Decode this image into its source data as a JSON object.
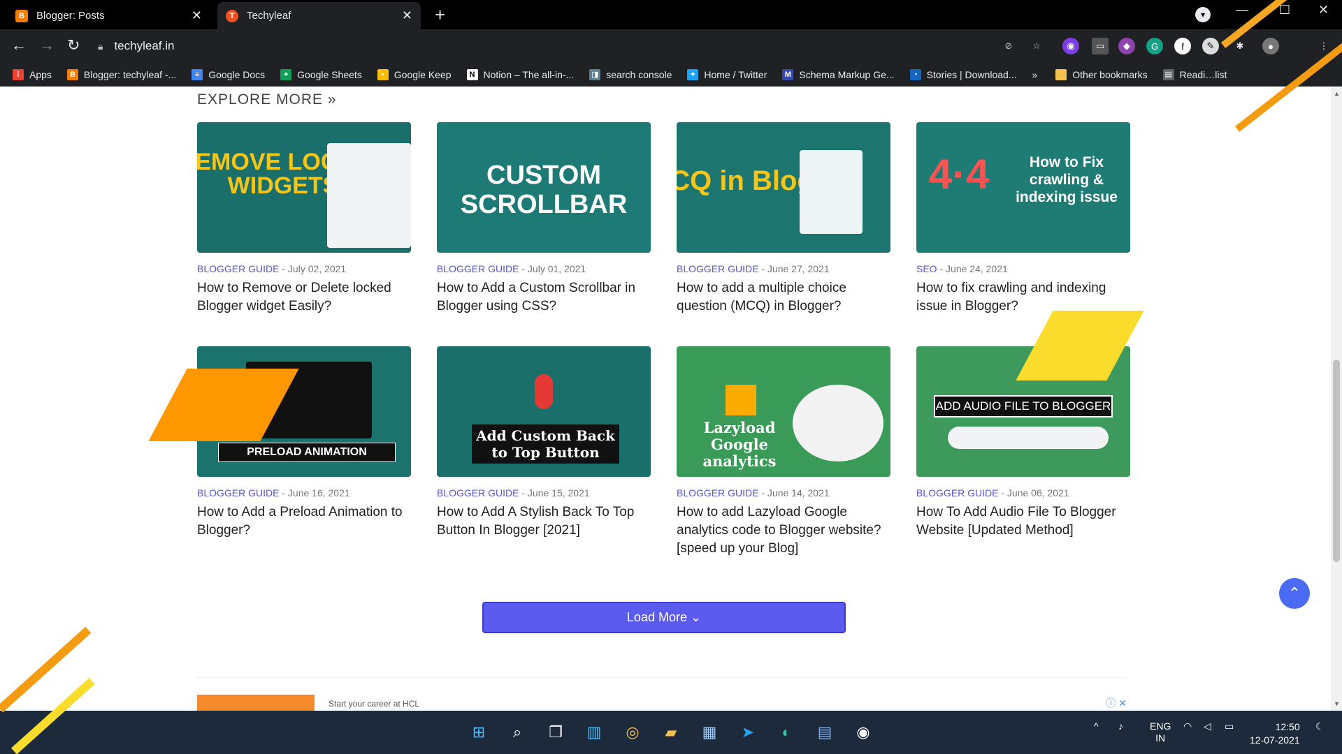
{
  "tabs": [
    {
      "title": "Blogger: Posts",
      "favicon": "B"
    },
    {
      "title": "Techyleaf",
      "favicon": "T"
    }
  ],
  "toolbar": {
    "url": "techyleaf.in"
  },
  "bookmarks": [
    {
      "label": "Apps",
      "icon": "apps-grid-icon",
      "color": "#ea4335",
      "glyph": "⋮⋮"
    },
    {
      "label": "Blogger: techyleaf -...",
      "icon": "blogger-icon",
      "color": "#f57d00",
      "glyph": "B"
    },
    {
      "label": "Google Docs",
      "icon": "docs-icon",
      "color": "#4285f4",
      "glyph": "≡"
    },
    {
      "label": "Google Sheets",
      "icon": "sheets-icon",
      "color": "#0f9d58",
      "glyph": "+"
    },
    {
      "label": "Google Keep",
      "icon": "keep-icon",
      "color": "#fbbc04",
      "glyph": "▪"
    },
    {
      "label": "Notion – The all-in-...",
      "icon": "notion-icon",
      "color": "#444",
      "glyph": "N"
    },
    {
      "label": "search console",
      "icon": "search-console-icon",
      "color": "#607d8b",
      "glyph": "◨"
    },
    {
      "label": "Home / Twitter",
      "icon": "twitter-icon",
      "color": "#1da1f2",
      "glyph": "✦"
    },
    {
      "label": "Schema Markup Ge...",
      "icon": "schema-icon",
      "color": "#3949ab",
      "glyph": "M"
    },
    {
      "label": "Stories | Download...",
      "icon": "stories-icon",
      "color": "#1565c0",
      "glyph": "◔"
    }
  ],
  "bookmarks_more": "»",
  "other_bookmarks": "Other bookmarks",
  "reading_list": "Readi…list",
  "page": {
    "explore": "EXPLORE MORE »",
    "load_more": "Load More ⌄",
    "ad_text": "Start your career at HCL"
  },
  "cards": [
    {
      "category": "BLOGGER GUIDE",
      "date": "July 02, 2021",
      "title": "How to Remove or Delete locked Blogger widget Easily?",
      "thumb_text": "REMOVE LOCKED WIDGETS",
      "thumb_color": "#1b6f6a"
    },
    {
      "category": "BLOGGER GUIDE",
      "date": "July 01, 2021",
      "title": "How to Add a Custom Scrollbar in Blogger using CSS?",
      "thumb_text": "CUSTOM SCROLLBAR",
      "thumb_color": "#1e7a74"
    },
    {
      "category": "BLOGGER GUIDE",
      "date": "June 27, 2021",
      "title": "How to add a multiple choice question (MCQ) in Blogger?",
      "thumb_text": "MCQ in Blogger",
      "thumb_color": "#1d7570"
    },
    {
      "category": "SEO",
      "date": "June 24, 2021",
      "title": "How to fix crawling and indexing issue in Blogger?",
      "thumb_text": "How to Fix crawling & indexing issue",
      "thumb_color": "#1f7c75"
    },
    {
      "category": "BLOGGER GUIDE",
      "date": "June 16, 2021",
      "title": "How to Add a Preload Animation to Blogger?",
      "thumb_text": "PRELOAD ANIMATION",
      "thumb_color": "#1c726c"
    },
    {
      "category": "BLOGGER GUIDE",
      "date": "June 15, 2021",
      "title": "How to Add A Stylish Back To Top Button In Blogger [2021]",
      "thumb_text": "Add Custom Back to Top Button",
      "thumb_color": "#1b6f6a"
    },
    {
      "category": "BLOGGER GUIDE",
      "date": "June 14, 2021",
      "title": "How to add Lazyload Google analytics code to Blogger website? [speed up your Blog]",
      "thumb_text": "Lazyload Google analytics",
      "thumb_color": "#3a9a58"
    },
    {
      "category": "BLOGGER GUIDE",
      "date": "June 06, 2021",
      "title": "How To Add Audio File To Blogger Website [Updated Method]",
      "thumb_text": "ADD AUDIO FILE TO BLOGGER",
      "thumb_color": "#3d9a5c"
    }
  ],
  "taskbar": {
    "lang": "ENG",
    "region": "IN",
    "time": "12:50",
    "date": "12-07-2021"
  }
}
